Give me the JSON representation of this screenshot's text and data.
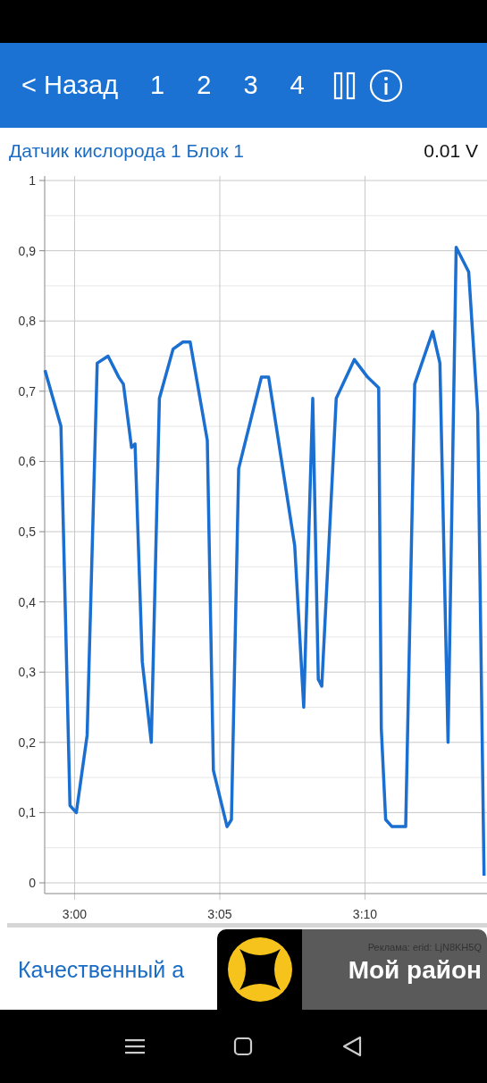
{
  "app_bar": {
    "back": "< Назад",
    "tabs": [
      {
        "label": "1"
      },
      {
        "label": "2"
      },
      {
        "label": "3"
      },
      {
        "label": "4"
      }
    ]
  },
  "sensor": {
    "title": "Датчик кислорода 1 Блок 1",
    "reading": "0.01 V",
    "chart_data": {
      "type": "line",
      "xlim": [
        178.97,
        194.2
      ],
      "ylim": [
        0,
        1
      ],
      "xticks": [
        {
          "value": 180,
          "label": "3:00"
        },
        {
          "value": 185,
          "label": "3:05"
        },
        {
          "value": 190,
          "label": "3:10"
        }
      ],
      "yticks": [
        {
          "value": 0,
          "label": "0"
        },
        {
          "value": 0.1,
          "label": "0,1"
        },
        {
          "value": 0.2,
          "label": "0,2"
        },
        {
          "value": 0.3,
          "label": "0,3"
        },
        {
          "value": 0.4,
          "label": "0,4"
        },
        {
          "value": 0.5,
          "label": "0,5"
        },
        {
          "value": 0.6,
          "label": "0,6"
        },
        {
          "value": 0.7,
          "label": "0,7"
        },
        {
          "value": 0.8,
          "label": "0,8"
        },
        {
          "value": 0.9,
          "label": "0,9"
        },
        {
          "value": 1,
          "label": "1"
        }
      ],
      "x": [
        178.98,
        179.53,
        179.84,
        180.06,
        180.43,
        180.78,
        181.15,
        181.52,
        181.68,
        181.96,
        182.08,
        182.33,
        182.64,
        182.92,
        183.39,
        183.73,
        183.98,
        184.57,
        184.78,
        185.25,
        185.4,
        185.65,
        186.43,
        186.68,
        187.58,
        187.89,
        188.2,
        188.39,
        188.51,
        189.01,
        189.63,
        190.09,
        190.47,
        190.56,
        190.71,
        190.93,
        191.4,
        191.71,
        192.33,
        192.58,
        192.86,
        193.14,
        193.57,
        193.88,
        194.1
      ],
      "grid": true,
      "series": [
        {
          "color": "#1a6fd0",
          "values": [
            0.73,
            0.65,
            0.11,
            0.1,
            0.21,
            0.74,
            0.75,
            0.72,
            0.71,
            0.62,
            0.625,
            0.315,
            0.2,
            0.69,
            0.76,
            0.77,
            0.77,
            0.63,
            0.16,
            0.08,
            0.09,
            0.59,
            0.72,
            0.72,
            0.48,
            0.25,
            0.69,
            0.29,
            0.28,
            0.69,
            0.745,
            0.72,
            0.705,
            0.22,
            0.09,
            0.08,
            0.08,
            0.71,
            0.785,
            0.74,
            0.2,
            0.905,
            0.87,
            0.67,
            0.01
          ]
        }
      ]
    }
  },
  "footer_link": "Качественный а",
  "ad": {
    "label": "Реклама: erid: LjN8KH5Q",
    "title": "Мой район"
  }
}
